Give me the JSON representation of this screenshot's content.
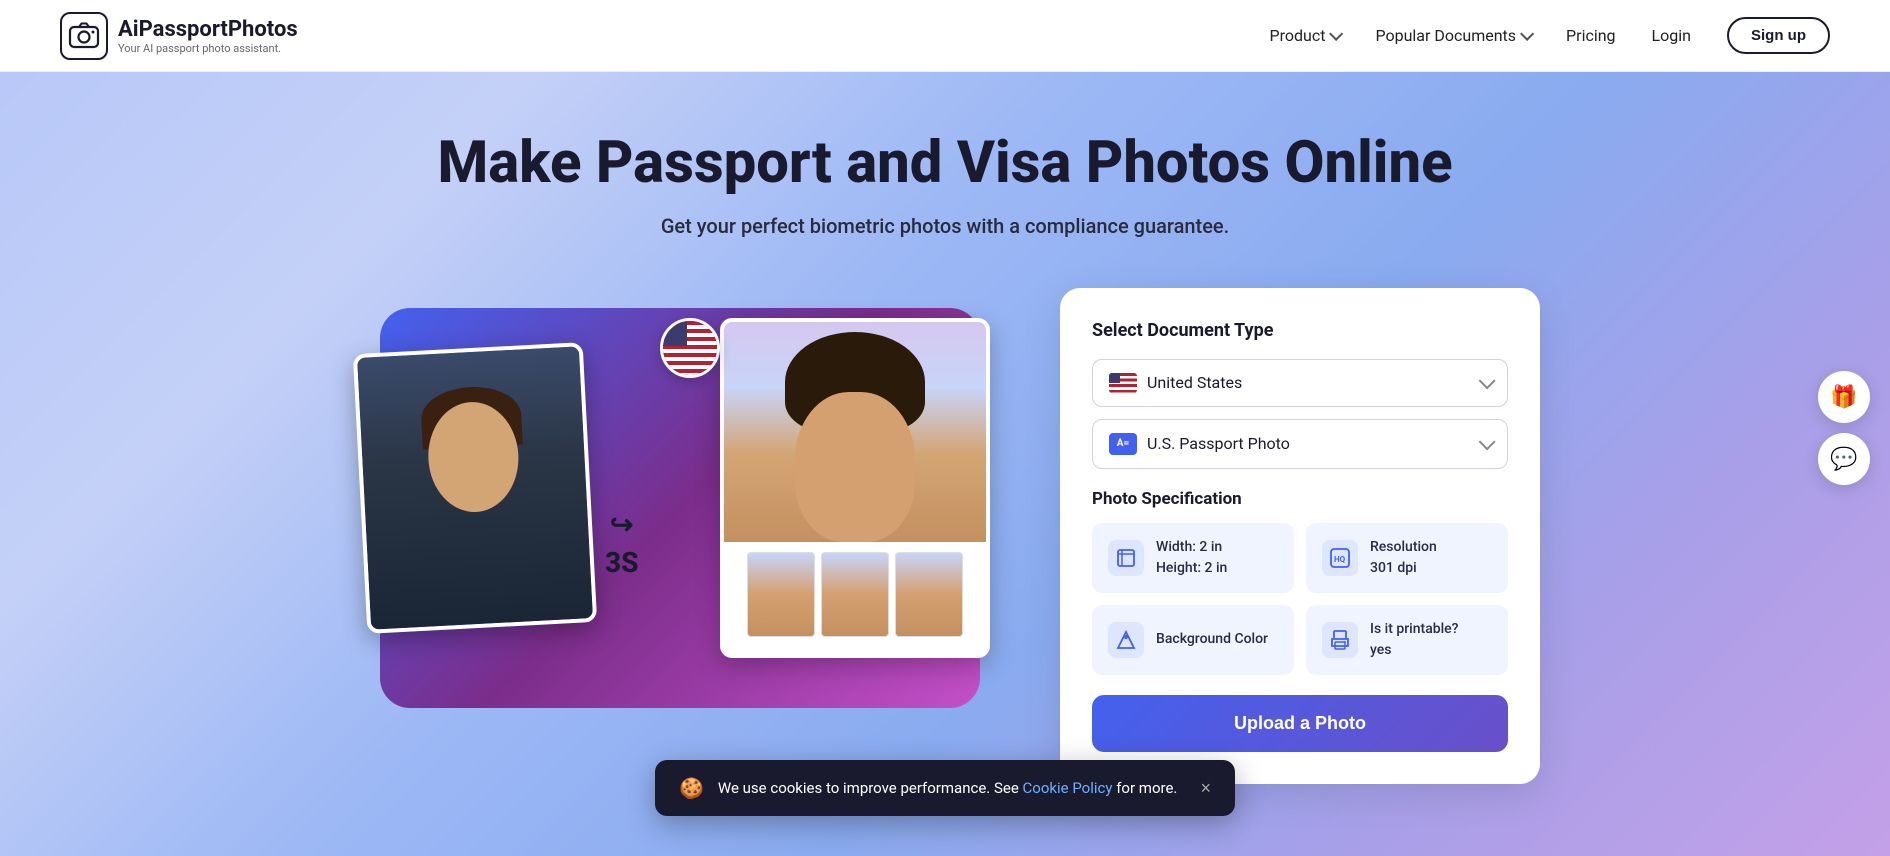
{
  "header": {
    "logo_title": "AiPassportPhotos",
    "logo_subtitle": "Your AI passport photo assistant.",
    "nav": {
      "product_label": "Product",
      "popular_docs_label": "Popular Documents",
      "pricing_label": "Pricing",
      "login_label": "Login",
      "signup_label": "Sign up"
    }
  },
  "hero": {
    "title": "Make Passport and Visa Photos Online",
    "subtitle": "Get your perfect biometric photos with a compliance guarantee.",
    "time_label": "3S",
    "arrow_label": "→"
  },
  "panel": {
    "select_document_label": "Select Document Type",
    "country_value": "United States",
    "document_value": "U.S. Passport Photo",
    "document_icon_label": "A=",
    "spec_title": "Photo Specification",
    "specs": [
      {
        "icon": "⊞",
        "text": "Width: 2 in\nHeight: 2 in"
      },
      {
        "icon": "HQ",
        "text": "Resolution\n301 dpi"
      },
      {
        "icon": "◈",
        "text": "Background Color"
      },
      {
        "icon": "⊟",
        "text": "Is it printable?\nyes"
      }
    ],
    "upload_label": "Upload a Photo"
  },
  "cookie": {
    "icon": "🍪",
    "text": "We use cookies to improve performance. See",
    "link_text": "Cookie Policy",
    "link_after": "for more.",
    "close_label": "×"
  },
  "float_buttons": {
    "gift_icon": "🎁",
    "chat_icon": "💬"
  }
}
